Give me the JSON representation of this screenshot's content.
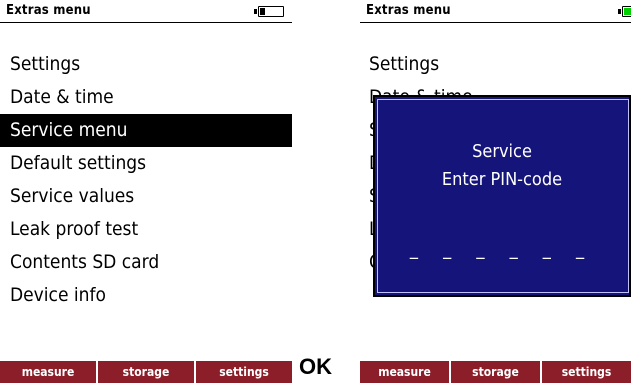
{
  "left_screen": {
    "title": "Extras menu",
    "menu": [
      "Settings",
      "Date & time",
      "Service menu",
      "Default settings",
      "Service values",
      "Leak proof test",
      "Contents SD card",
      "Device info"
    ],
    "selected_index": 2,
    "battery": {
      "fill_fraction": 0.25,
      "fill_color": "#000000"
    },
    "softkeys": [
      "measure",
      "storage",
      "settings"
    ]
  },
  "ok_label": "OK",
  "right_screen": {
    "title": "Extras menu",
    "menu": [
      "Settings",
      "Date & time",
      "Service menu",
      "Default settings",
      "Service values",
      "Leak proof test",
      "Contents SD card"
    ],
    "battery": {
      "fill_fraction": 0.5,
      "fill_color": "#00d000"
    },
    "dialog": {
      "title": "Service",
      "prompt": "Enter PIN-code",
      "pin_placeholder": "_ _ _ _ _ _"
    },
    "softkeys": [
      "measure",
      "storage",
      "settings"
    ]
  },
  "colors": {
    "softkey_bg": "#8b1e28",
    "dialog_bg": "#14147a",
    "selected_bg": "#000000"
  }
}
